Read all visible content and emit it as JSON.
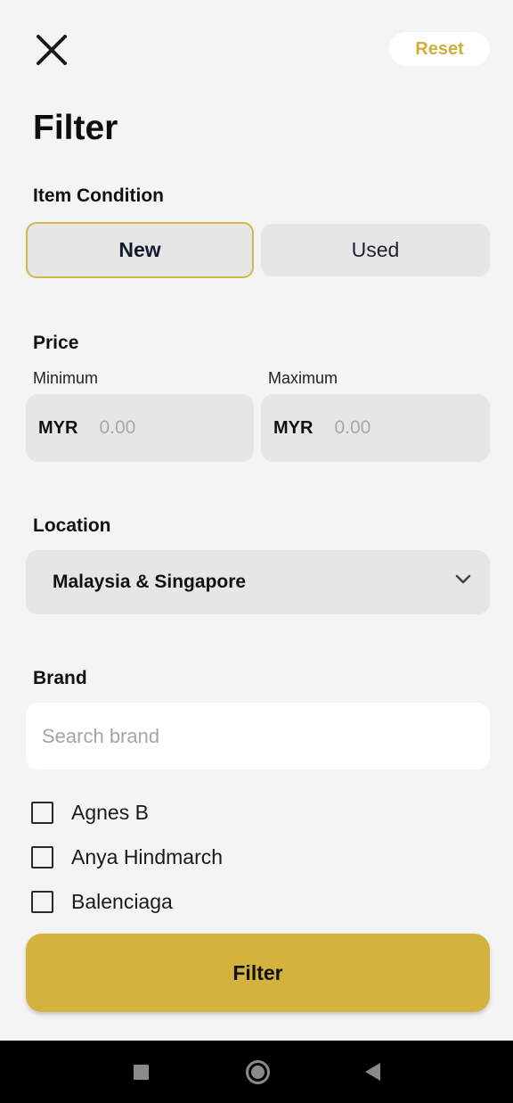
{
  "header": {
    "close_icon": "close-icon",
    "reset_label": "Reset",
    "title": "Filter"
  },
  "item_condition": {
    "label": "Item Condition",
    "options": [
      "New",
      "Used"
    ],
    "selected": "New"
  },
  "price": {
    "label": "Price",
    "minimum": {
      "label": "Minimum",
      "currency": "MYR",
      "placeholder": "0.00",
      "value": ""
    },
    "maximum": {
      "label": "Maximum",
      "currency": "MYR",
      "placeholder": "0.00",
      "value": ""
    }
  },
  "location": {
    "label": "Location",
    "selected": "Malaysia & Singapore",
    "icon": "chevron-down-icon"
  },
  "brand": {
    "label": "Brand",
    "search_placeholder": "Search brand",
    "items": [
      {
        "name": "Agnes B",
        "checked": false
      },
      {
        "name": "Anya Hindmarch",
        "checked": false
      },
      {
        "name": "Balenciaga",
        "checked": false
      }
    ]
  },
  "actions": {
    "filter_label": "Filter"
  },
  "colors": {
    "accent": "#d3b23d",
    "reset_text": "#cfae3b",
    "background": "#f4f4f4",
    "field": "#e6e6e6"
  },
  "system_nav": {
    "icons": [
      "recent-apps-icon",
      "home-icon",
      "back-icon"
    ]
  }
}
